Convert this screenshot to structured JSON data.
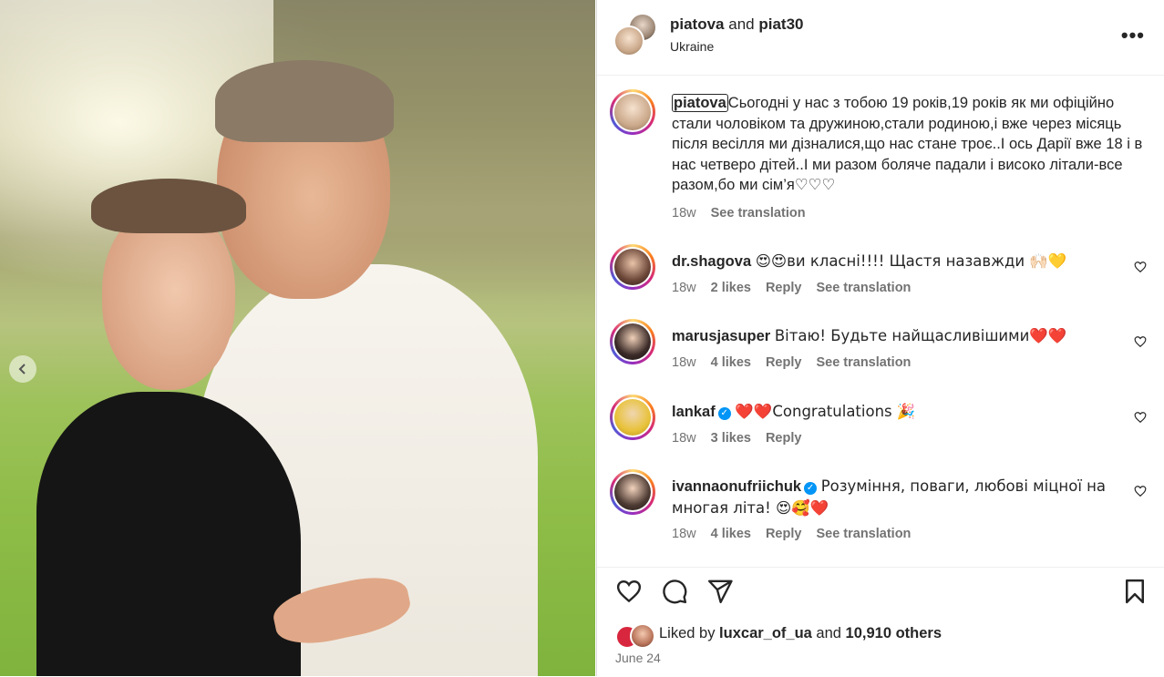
{
  "header": {
    "user1": "piatova",
    "and": " and ",
    "user2": "piat30",
    "location": "Ukraine",
    "more": "•••"
  },
  "caption": {
    "username": "piatova",
    "text": "Сьогодні у нас з тобою 19 років,19 років як ми офіційно стали чоловіком та дружиною,стали родиною,і вже через місяць після весілля ми дізналися,що нас стане троє..І ось Дарії вже 18 і в нас четверо дітей..І ми разом боляче падали і високо літали-все разом,бо ми сім’я♡♡♡",
    "time": "18w",
    "translation": "See translation"
  },
  "comments": [
    {
      "username": "dr.shagova",
      "verified": false,
      "text": "😍😍ви класні!!!! Щастя назавжди 🙌🏻💛",
      "time": "18w",
      "likes": "2 likes",
      "reply": "Reply",
      "translation": "See translation"
    },
    {
      "username": "marusjasuper",
      "verified": false,
      "text": "Вітаю! Будьте найщасливішими❤️❤️",
      "time": "18w",
      "likes": "4 likes",
      "reply": "Reply",
      "translation": "See translation"
    },
    {
      "username": "lankaf",
      "verified": true,
      "text": "❤️❤️Congratulations 🎉",
      "time": "18w",
      "likes": "3 likes",
      "reply": "Reply",
      "translation": ""
    },
    {
      "username": "ivannaonufriichuk",
      "verified": true,
      "text": "Розуміння, поваги, любові міцної на многая літа! 😍🥰❤️",
      "time": "18w",
      "likes": "4 likes",
      "reply": "Reply",
      "translation": "See translation"
    }
  ],
  "likes": {
    "prefix": "Liked by ",
    "user": "luxcar_of_ua",
    "middle": " and ",
    "others": "10,910 others"
  },
  "date": "June 24",
  "icons": {
    "like": "heart-icon",
    "comment": "comment-icon",
    "share": "share-icon",
    "save": "bookmark-icon",
    "prev": "chevron-left-icon"
  }
}
